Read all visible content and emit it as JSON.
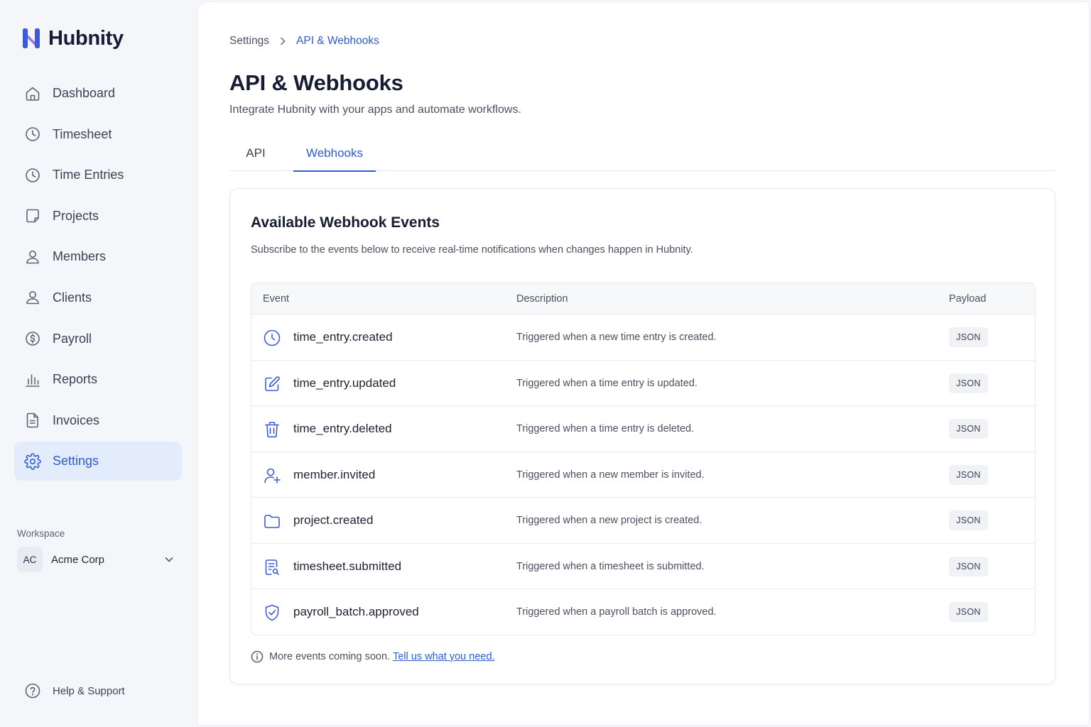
{
  "app": {
    "name": "Hubnity",
    "logo_icon": "hubnity-logo-icon",
    "brand_color": "#2f5bd3"
  },
  "sidebar": {
    "items": [
      {
        "label": "Dashboard",
        "icon": "home-icon",
        "active": false
      },
      {
        "label": "Timesheet",
        "icon": "clock-icon",
        "active": false
      },
      {
        "label": "Time Entries",
        "icon": "clock-icon",
        "active": false
      },
      {
        "label": "Projects",
        "icon": "square-icon",
        "active": false
      },
      {
        "label": "Members",
        "icon": "user-icon",
        "active": false
      },
      {
        "label": "Clients",
        "icon": "user-icon",
        "active": false
      },
      {
        "label": "Payroll",
        "icon": "dollar-circle-icon",
        "active": false
      },
      {
        "label": "Reports",
        "icon": "bar-chart-icon",
        "active": false
      },
      {
        "label": "Invoices",
        "icon": "document-icon",
        "active": false
      },
      {
        "label": "Settings",
        "icon": "gear-icon",
        "active": true
      }
    ],
    "workspace": {
      "label": "Workspace",
      "initials": "AC",
      "name": "Acme Corp"
    },
    "help": {
      "label": "Help & Support",
      "icon": "question-circle-icon"
    }
  },
  "breadcrumb": {
    "root": "Settings",
    "current": "API & Webhooks"
  },
  "page": {
    "title": "API & Webhooks",
    "subtitle": "Integrate Hubnity with your apps and automate workflows."
  },
  "tabs": [
    {
      "label": "API",
      "active": false
    },
    {
      "label": "Webhooks",
      "active": true
    }
  ],
  "card": {
    "title": "Available Webhook Events",
    "subtitle": "Subscribe to the events below to receive real-time notifications when changes happen in Hubnity.",
    "columns": {
      "event": "Event",
      "description": "Description",
      "payload": "Payload"
    },
    "events": [
      {
        "icon": "clock-icon",
        "name": "time_entry.created",
        "description": "Triggered when a new time entry is created.",
        "payload": "JSON"
      },
      {
        "icon": "edit-icon",
        "name": "time_entry.updated",
        "description": "Triggered when a time entry is updated.",
        "payload": "JSON"
      },
      {
        "icon": "trash-icon",
        "name": "time_entry.deleted",
        "description": "Triggered when a time entry is deleted.",
        "payload": "JSON"
      },
      {
        "icon": "user-plus-icon",
        "name": "member.invited",
        "description": "Triggered when a new member is invited.",
        "payload": "JSON"
      },
      {
        "icon": "folder-icon",
        "name": "project.created",
        "description": "Triggered when a new project is created.",
        "payload": "JSON"
      },
      {
        "icon": "document-search-icon",
        "name": "timesheet.submitted",
        "description": "Triggered when a timesheet is submitted.",
        "payload": "JSON"
      },
      {
        "icon": "shield-check-icon",
        "name": "payroll_batch.approved",
        "description": "Triggered when a payroll batch is approved.",
        "payload": "JSON"
      }
    ],
    "footer": {
      "text": "More events coming soon.",
      "link": "Tell us what you need.",
      "icon": "info-icon"
    }
  }
}
